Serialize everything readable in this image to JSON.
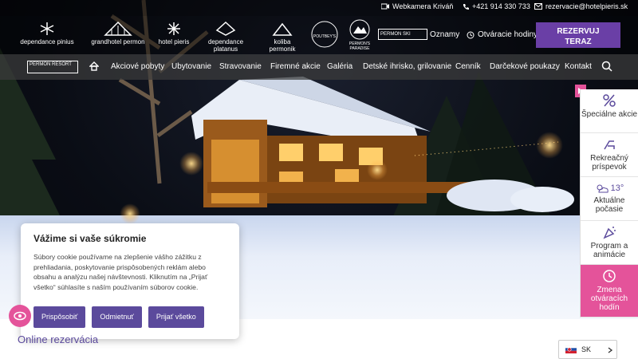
{
  "topbar": {
    "webcam": "Webkamera Kriváň",
    "phone": "+421 914 330 733",
    "email": "rezervacie@hotelpieris.sk"
  },
  "logos": [
    {
      "label": "dependance pinius"
    },
    {
      "label": "grandhotel permon"
    },
    {
      "label": "hotel pieris"
    },
    {
      "label": "dependance platanus"
    },
    {
      "label": "koliba permonik"
    },
    {
      "label": "POUTBEY'S"
    },
    {
      "label": "PERMON'S PARADISE"
    },
    {
      "label": "PERMON SKI"
    }
  ],
  "header": {
    "oznamy": "Oznamy",
    "hours": "Otváracie hodiny",
    "reserve_line1": "REZERVUJ",
    "reserve_line2": "TERAZ"
  },
  "nav": {
    "logo": "PERMON RESORT",
    "items": [
      "Akciové pobyty",
      "Ubytovanie",
      "Stravovanie",
      "Firemné akcie",
      "Galéria",
      "Detské ihrisko, grilovanie",
      "Cenník",
      "Darčekové poukazy",
      "Kontakt"
    ]
  },
  "side": {
    "items": [
      {
        "label": "Špeciálne akcie",
        "icon": "percent-icon"
      },
      {
        "label": "Rekreačný príspevok",
        "icon": "deckchair-icon"
      },
      {
        "label": "Aktuálne počasie",
        "temp": "13°",
        "icon": "weather-icon"
      },
      {
        "label": "Program a animácie",
        "icon": "confetti-icon"
      },
      {
        "label": "Zmena otváracích hodín",
        "icon": "clock-icon"
      }
    ]
  },
  "cookie": {
    "title": "Vážime si vaše súkromie",
    "text": "Súbory cookie používame na zlepšenie vášho zážitku z prehliadania, poskytovanie prispôsobených reklám alebo obsahu a analýzu našej návštevnosti. Kliknutím na „Prijať všetko“ súhlasíte s naším používaním súborov cookie.",
    "customize": "Prispôsobiť",
    "reject": "Odmietnuť",
    "accept": "Prijať všetko"
  },
  "booking": {
    "title": "Online rezervácia"
  },
  "lang": {
    "code": "SK"
  },
  "colors": {
    "accent": "#6a3fa6",
    "pink": "#e4539a",
    "purple_btn": "#5b4a9c"
  }
}
